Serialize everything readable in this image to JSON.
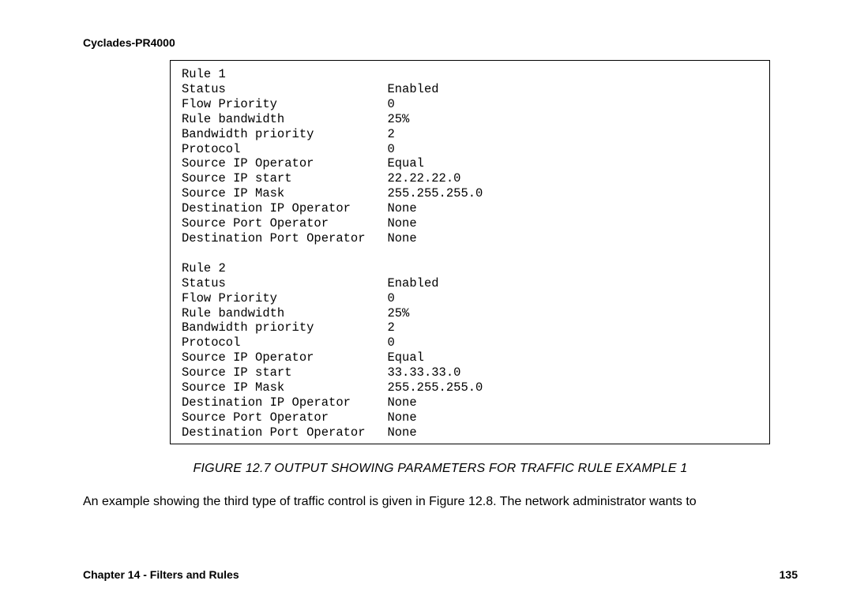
{
  "header": {
    "product": "Cyclades-PR4000"
  },
  "figure": {
    "rules": [
      {
        "title": "Rule 1",
        "rows": [
          {
            "label": "Status",
            "value": "Enabled"
          },
          {
            "label": "Flow Priority",
            "value": "0"
          },
          {
            "label": "Rule bandwidth",
            "value": "25%"
          },
          {
            "label": "Bandwidth priority",
            "value": "2"
          },
          {
            "label": "Protocol",
            "value": "0"
          },
          {
            "label": "Source IP Operator",
            "value": "Equal"
          },
          {
            "label": "Source IP start",
            "value": "22.22.22.0"
          },
          {
            "label": "Source IP Mask",
            "value": "255.255.255.0"
          },
          {
            "label": "Destination IP Operator",
            "value": "None"
          },
          {
            "label": "Source Port Operator",
            "value": "None"
          },
          {
            "label": "Destination Port Operator",
            "value": "None"
          }
        ]
      },
      {
        "title": "Rule 2",
        "rows": [
          {
            "label": "Status",
            "value": "Enabled"
          },
          {
            "label": "Flow Priority",
            "value": "0"
          },
          {
            "label": "Rule bandwidth",
            "value": "25%"
          },
          {
            "label": "Bandwidth priority",
            "value": "2"
          },
          {
            "label": "Protocol",
            "value": "0"
          },
          {
            "label": "Source IP Operator",
            "value": "Equal"
          },
          {
            "label": "Source IP start",
            "value": "33.33.33.0"
          },
          {
            "label": "Source IP Mask",
            "value": "255.255.255.0"
          },
          {
            "label": "Destination IP Operator",
            "value": "None"
          },
          {
            "label": "Source Port Operator",
            "value": "None"
          },
          {
            "label": "Destination Port Operator",
            "value": "None"
          }
        ]
      }
    ],
    "caption": "FIGURE 12.7  OUTPUT SHOWING PARAMETERS FOR TRAFFIC RULE EXAMPLE 1"
  },
  "body": {
    "paragraph": "An example showing the third type of traffic control is given in Figure 12.8.  The network administrator wants to"
  },
  "footer": {
    "chapter": "Chapter 14 - Filters and Rules",
    "page_number": "135"
  },
  "layout": {
    "label_col_width": 28
  }
}
